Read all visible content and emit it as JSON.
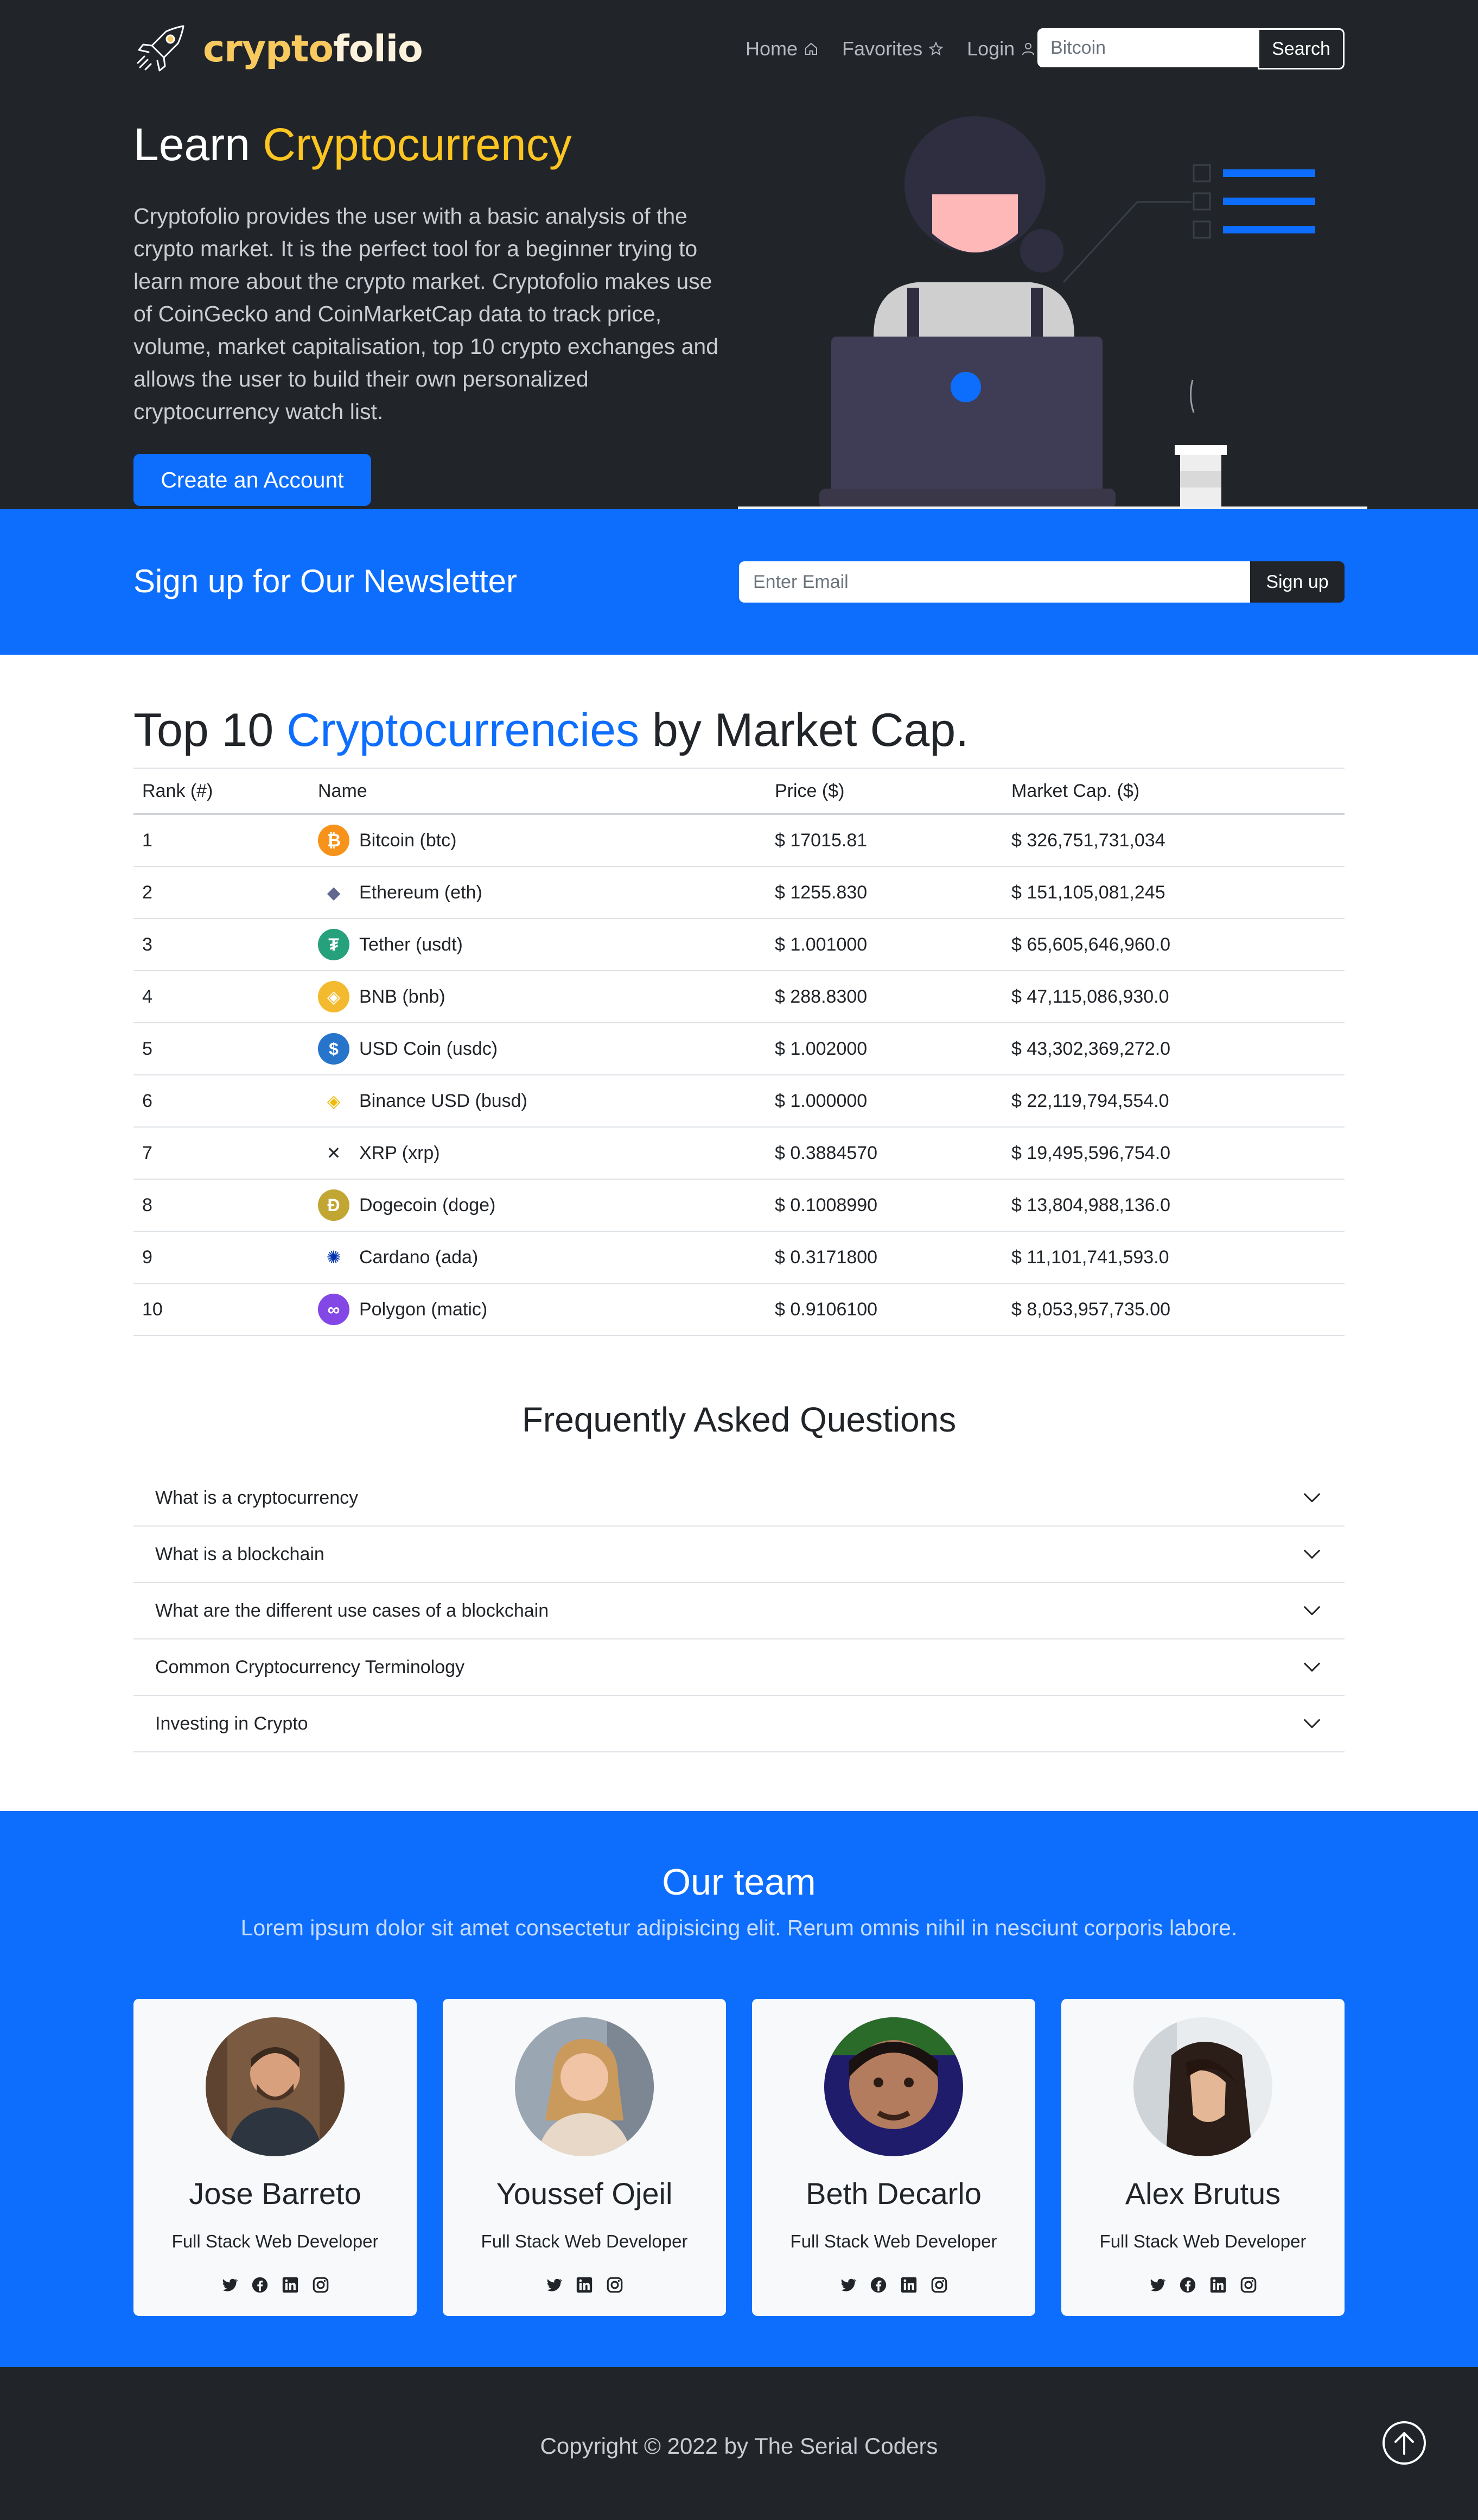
{
  "header": {
    "brand_part1": "crypto",
    "brand_part2": "folio",
    "nav": [
      {
        "label": "Home",
        "icon": "home-icon"
      },
      {
        "label": "Favorites",
        "icon": "star-icon"
      },
      {
        "label": "Login",
        "icon": "user-icon"
      }
    ],
    "search_value": "Bitcoin",
    "search_button": "Search"
  },
  "hero": {
    "title_plain": "Learn ",
    "title_highlight": "Cryptocurrency",
    "text": "Cryptofolio provides the user with a basic analysis of the crypto market. It is the perfect tool for a beginner trying to learn more about the crypto market. Cryptofolio makes use of CoinGecko and CoinMarketCap data to track price, volume, market capitalisation, top 10 crypto exchanges and allows the user to build their own personalized cryptocurrency watch list.",
    "cta": "Create an Account"
  },
  "newsletter": {
    "title": "Sign up for Our Newsletter",
    "placeholder": "Enter Email",
    "button": "Sign up"
  },
  "top10": {
    "title_a": "Top 10 ",
    "title_hl": "Cryptocurrencies",
    "title_b": " by Market Cap.",
    "headers": [
      "Rank (#)",
      "Name",
      "Price ($)",
      "Market Cap. ($)"
    ],
    "rows": [
      {
        "rank": "1",
        "name": "Bitcoin (btc)",
        "price": "$ 17015.81",
        "cap": "$ 326,751,731,034",
        "icon_color": "#f7931a",
        "glyph": "₿"
      },
      {
        "rank": "2",
        "name": "Ethereum (eth)",
        "price": "$ 1255.830",
        "cap": "$ 151,105,081,245",
        "icon_color": "#ffffff",
        "glyph": "◆"
      },
      {
        "rank": "3",
        "name": "Tether (usdt)",
        "price": "$ 1.001000",
        "cap": "$ 65,605,646,960.0",
        "icon_color": "#26a17b",
        "glyph": "₮"
      },
      {
        "rank": "4",
        "name": "BNB (bnb)",
        "price": "$ 288.8300",
        "cap": "$ 47,115,086,930.0",
        "icon_color": "#f3ba2f",
        "glyph": "◈"
      },
      {
        "rank": "5",
        "name": "USD Coin (usdc)",
        "price": "$ 1.002000",
        "cap": "$ 43,302,369,272.0",
        "icon_color": "#2775ca",
        "glyph": "$"
      },
      {
        "rank": "6",
        "name": "Binance USD (busd)",
        "price": "$ 1.000000",
        "cap": "$ 22,119,794,554.0",
        "icon_color": "#ffffff",
        "glyph": "◈"
      },
      {
        "rank": "7",
        "name": "XRP (xrp)",
        "price": "$ 0.3884570",
        "cap": "$ 19,495,596,754.0",
        "icon_color": "#ffffff",
        "glyph": "✕"
      },
      {
        "rank": "8",
        "name": "Dogecoin (doge)",
        "price": "$ 0.1008990",
        "cap": "$ 13,804,988,136.0",
        "icon_color": "#c2a633",
        "glyph": "Ð"
      },
      {
        "rank": "9",
        "name": "Cardano (ada)",
        "price": "$ 0.3171800",
        "cap": "$ 11,101,741,593.0",
        "icon_color": "#ffffff",
        "glyph": "✺"
      },
      {
        "rank": "10",
        "name": "Polygon (matic)",
        "price": "$ 0.9106100",
        "cap": "$ 8,053,957,735.00",
        "icon_color": "#8247e5",
        "glyph": "∞"
      }
    ]
  },
  "faq": {
    "title": "Frequently Asked Questions",
    "items": [
      "What is a cryptocurrency",
      "What is a blockchain",
      "What are the different use cases of a blockchain",
      "Common Cryptocurrency Terminology",
      "Investing in Crypto"
    ]
  },
  "team": {
    "title": "Our team",
    "subtitle": "Lorem ipsum dolor sit amet consectetur adipisicing elit. Rerum omnis nihil in nesciunt corporis labore.",
    "members": [
      {
        "name": "Jose Barreto",
        "role": "Full Stack Web Developer",
        "socials": [
          "twitter-icon",
          "facebook-icon",
          "linkedin-icon",
          "instagram-icon"
        ]
      },
      {
        "name": "Youssef Ojeil",
        "role": "Full Stack Web Developer",
        "socials": [
          "twitter-icon",
          "linkedin-icon",
          "instagram-icon"
        ]
      },
      {
        "name": "Beth Decarlo",
        "role": "Full Stack Web Developer",
        "socials": [
          "twitter-icon",
          "facebook-icon",
          "linkedin-icon",
          "instagram-icon"
        ]
      },
      {
        "name": "Alex Brutus",
        "role": "Full Stack Web Developer",
        "socials": [
          "twitter-icon",
          "facebook-icon",
          "linkedin-icon",
          "instagram-icon"
        ]
      }
    ]
  },
  "footer": {
    "copyright": "Copyright © 2022 by The Serial Coders"
  },
  "colors": {
    "primary": "#0d6efd",
    "dark": "#212529",
    "accent_yellow": "#fcc521",
    "brand_gold": "#f7c95f"
  }
}
